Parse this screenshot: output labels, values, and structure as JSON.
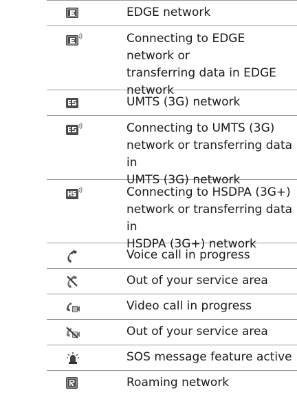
{
  "rows": [
    {
      "icon": "edge-icon",
      "lines": [
        "EDGE network"
      ]
    },
    {
      "icon": "edge-transfer-icon",
      "lines": [
        "Connecting to EDGE network or",
        "transferring data in EDGE",
        "network"
      ]
    },
    {
      "icon": "umts-3g-icon",
      "lines": [
        "UMTS (3G) network"
      ]
    },
    {
      "icon": "umts-3g-transfer-icon",
      "lines": [
        "Connecting to UMTS (3G)",
        "network or transferring data in",
        "UMTS (3G) network"
      ]
    },
    {
      "icon": "hsdpa-transfer-icon",
      "lines": [
        "Connecting to HSDPA (3G+)",
        "network or transferring data in",
        "HSDPA (3G+) network"
      ]
    },
    {
      "icon": "voice-call-icon",
      "lines": [
        "Voice call in progress"
      ]
    },
    {
      "icon": "voice-no-service-icon",
      "lines": [
        "Out of your service area"
      ]
    },
    {
      "icon": "video-call-icon",
      "lines": [
        "Video call in progress"
      ]
    },
    {
      "icon": "video-no-service-icon",
      "lines": [
        "Out of your service area"
      ]
    },
    {
      "icon": "sos-alarm-icon",
      "lines": [
        "SOS message feature active"
      ]
    },
    {
      "icon": "roaming-icon",
      "lines": [
        "Roaming network"
      ]
    }
  ]
}
